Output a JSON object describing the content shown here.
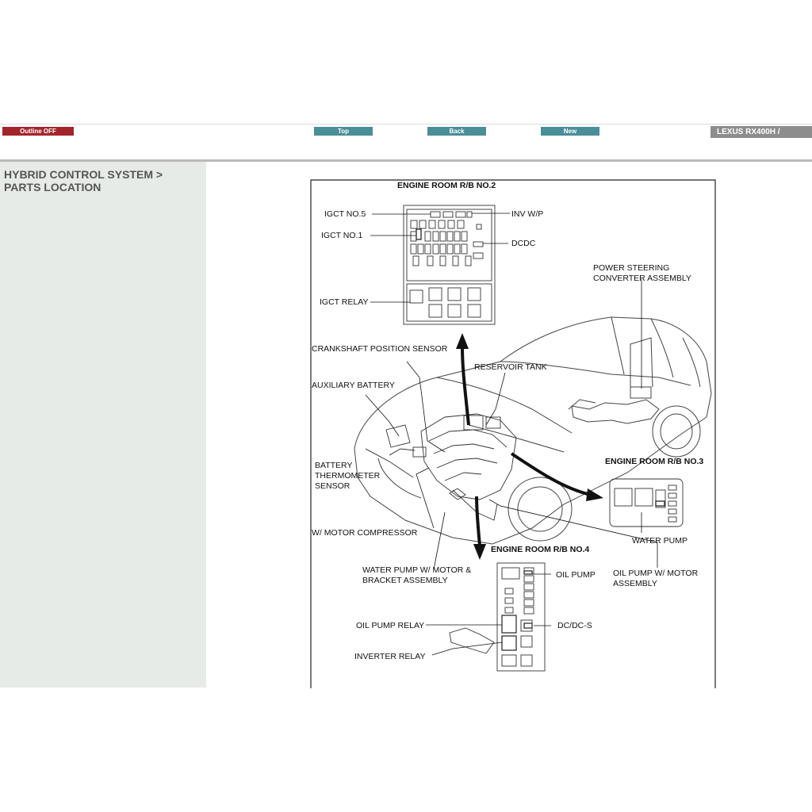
{
  "toolbar": {
    "outline_label": "Outline OFF",
    "top_label": "Top",
    "back_label": "Back",
    "new_label": "New",
    "model": "LEXUS RX400H /"
  },
  "sidebar": {
    "title_line1": "HYBRID CONTROL SYSTEM >",
    "title_line2": "PARTS LOCATION"
  },
  "diagram": {
    "engine_room_rb2": "ENGINE ROOM R/B NO.2",
    "engine_room_rb3": "ENGINE ROOM R/B NO.3",
    "engine_room_rb4": "ENGINE ROOM R/B NO.4",
    "igct_no5": "IGCT NO.5",
    "inv_wp": "INV W/P",
    "igct_no1": "IGCT NO.1",
    "dcdc": "DCDC",
    "igct_relay": "IGCT RELAY",
    "power_steering_l1": "POWER STEERING",
    "power_steering_l2": "CONVERTER ASSEMBLY",
    "crankshaft": "CRANKSHAFT POSITION SENSOR",
    "reservoir": "RESERVOIR TANK",
    "aux_battery": "AUXILIARY BATTERY",
    "battery_therm_l1": "BATTERY",
    "battery_therm_l2": "THERMOMETER",
    "battery_therm_l3": "SENSOR",
    "motor_compressor": "W/ MOTOR COMPRESSOR",
    "water_pump": "WATER PUMP",
    "water_pump_motor_l1": "WATER PUMP W/ MOTOR &",
    "water_pump_motor_l2": "BRACKET ASSEMBLY",
    "oil_pump": "OIL PUMP",
    "oil_pump_motor_l1": "OIL PUMP W/ MOTOR",
    "oil_pump_motor_l2": "ASSEMBLY",
    "oil_pump_relay": "OIL PUMP RELAY",
    "dc_dc_s": "DC/DC-S",
    "inverter_relay": "INVERTER RELAY"
  }
}
